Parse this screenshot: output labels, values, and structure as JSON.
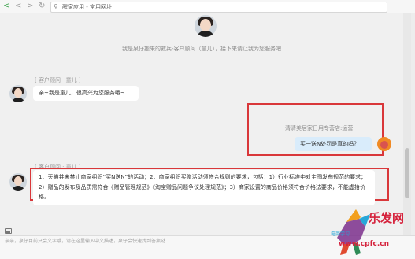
{
  "browser": {
    "nav_back": "<",
    "nav_forward": ">",
    "nav_refresh": "↻",
    "url_text": "醒家应用 - 常用网址"
  },
  "chat": {
    "system_message": "我是泉仔搬来的救兵-客户顾问（童儿），接下来请让我为您服务吧",
    "agent_label_1": "[ 客户顾问 · 童儿 ]",
    "agent_message_1": "亲~我是童儿，很高兴为您服务哦~",
    "customer_label": "清清美居家日用专营店:运营",
    "customer_message": "买一送N处罚是真的吗？",
    "agent_label_2": "[ 客户顾问 · 童儿 ]",
    "agent_message_2": "1、天猫并未禁止商家组织“买N送N”的活动；2、商家组织买赠活动须符合规则的要求，包括：1）行业标准中对主图发布规范的要求；2）赠品的发布及品质需符合《赠品管理规范》《淘宝赠品问题争议处理规范》；3）商家设置的商品价格须符合价格法要求，不能虚抬价格。"
  },
  "input": {
    "hint": "亲亲，泉仔目前只会文字哦，请在这里输入中文描述，泉仔会快速找到答案哒"
  },
  "watermark": {
    "title": "乐发网",
    "url": "www.cpfc.cn",
    "slogan": "电商学习"
  },
  "colors": {
    "highlight_box": "#d9373a",
    "customer_bubble": "#d9ecfb",
    "agent_bubble": "#ffffff"
  }
}
